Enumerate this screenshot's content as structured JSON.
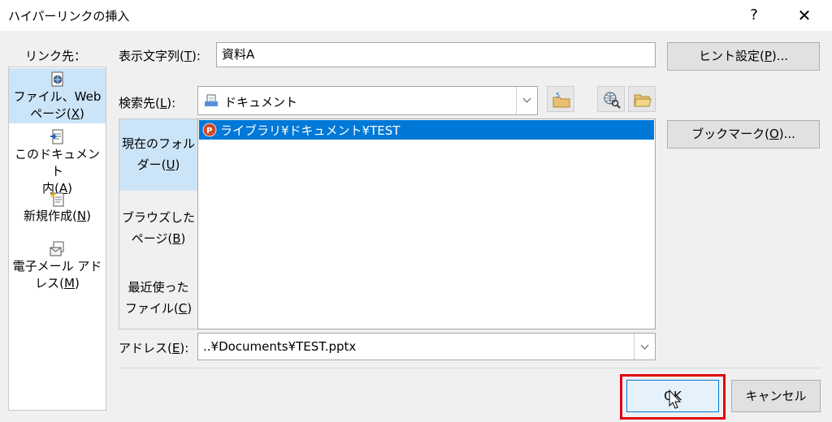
{
  "window": {
    "title": "ハイパーリンクの挿入",
    "help": "?",
    "close": "✕"
  },
  "link_to": {
    "label": "リンク先：",
    "items": [
      {
        "line1": "ファイル、Web",
        "line2_pre": "ページ(",
        "line2_key": "X",
        "line2_post": ")",
        "icon": "web-file-icon",
        "selected": true
      },
      {
        "line1": "このドキュメント",
        "line2_pre": "内(",
        "line2_key": "A",
        "line2_post": ")",
        "icon": "this-document-icon",
        "selected": false
      },
      {
        "line1": "",
        "line2_pre": "新規作成(",
        "line2_key": "N",
        "line2_post": ")",
        "icon": "new-document-icon",
        "selected": false
      },
      {
        "line1": "電子メール アド",
        "line2_pre": "レス(",
        "line2_key": "M",
        "line2_post": ")",
        "icon": "email-icon",
        "selected": false
      }
    ]
  },
  "display_text": {
    "label_pre": "表示文字列(",
    "label_key": "T",
    "label_post": "):",
    "value": "資料A"
  },
  "screentip_button": {
    "pre": "ヒント設定(",
    "key": "P",
    "post": ")..."
  },
  "look_in": {
    "label_pre": "検索先(",
    "label_key": "L",
    "label_post": "):",
    "value": "ドキュメント"
  },
  "side_tabs": [
    {
      "line1": "現在のフォル",
      "line2_pre": "ダー(",
      "line2_key": "U",
      "line2_post": ")",
      "selected": true
    },
    {
      "line1": "ブラウズした",
      "line2_pre": "ページ(",
      "line2_key": "B",
      "line2_post": ")",
      "selected": false
    },
    {
      "line1": "最近使った",
      "line2_pre": "ファイル(",
      "line2_key": "C",
      "line2_post": ")",
      "selected": false
    }
  ],
  "file_list": [
    {
      "name": "ライブラリ¥ドキュメント¥TEST",
      "icon": "powerpoint-file-icon",
      "selected": true
    }
  ],
  "bookmark_button": {
    "pre": "ブックマーク(",
    "key": "O",
    "post": ")..."
  },
  "address": {
    "label_pre": "アドレス(",
    "label_key": "E",
    "label_post": "):",
    "value": "..¥Documents¥TEST.pptx"
  },
  "ok_button": "OK",
  "cancel_button": "キャンセル",
  "colors": {
    "selection": "#0078d7",
    "nav_selected": "#cce4f7",
    "highlight_box": "#e0000f"
  }
}
